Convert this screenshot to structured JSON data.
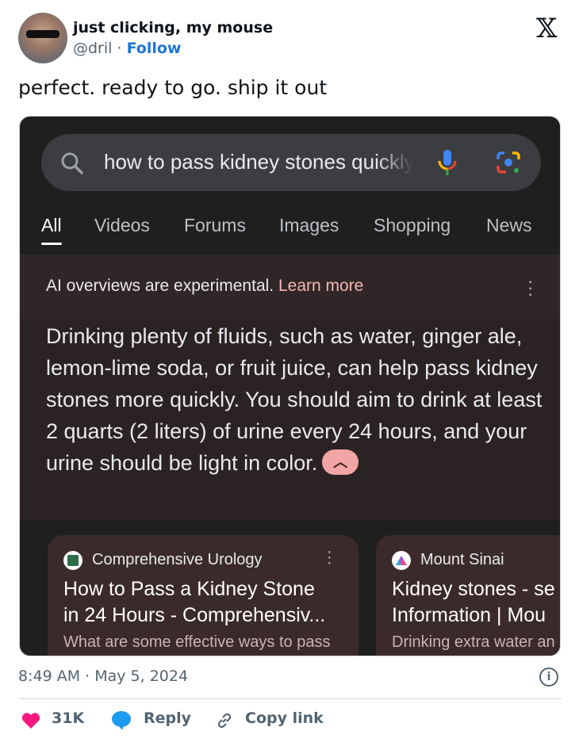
{
  "author": {
    "name": "just clicking, my mouse",
    "handle": "@dril",
    "separator": "·",
    "follow_label": "Follow"
  },
  "platform_icon": "x-logo-icon",
  "platform_logo_text": "𝕏",
  "tweet_text": "perfect. ready to go. ship it out",
  "screenshot": {
    "search_query": "how to pass kidney stones quickly",
    "tabs": [
      {
        "label": "All",
        "active": true
      },
      {
        "label": "Videos"
      },
      {
        "label": "Forums"
      },
      {
        "label": "Images"
      },
      {
        "label": "Shopping"
      },
      {
        "label": "News"
      }
    ],
    "ai_notice": "AI overviews are experimental.",
    "learn_more": "Learn more",
    "answer": "Drinking plenty of fluids, such as water, ginger ale, lemon-lime soda, or fruit juice, can help pass kidney stones more quickly. You should aim to drink at least 2 quarts (2 liters) of urine every 24 hours, and your urine should be light in color.",
    "cards": [
      {
        "source": "Comprehensive Urology",
        "title_line1": "How to Pass a Kidney Stone",
        "title_line2": "in 24 Hours - Comprehensiv...",
        "snippet": "What are some effective ways to pass"
      },
      {
        "source": "Mount Sinai",
        "title_line1": "Kidney stones - se",
        "title_line2": "Information | Mou",
        "snippet": "Drinking extra water an"
      }
    ],
    "colors": {
      "background": "#1f1f1f",
      "search_bar": "#3c3d40",
      "ai_panel": "#2b2323",
      "card": "#3b2a2a",
      "link": "#f2b8b5"
    }
  },
  "timestamp": "8:49 AM · May 5, 2024",
  "actions": {
    "likes": "31K",
    "reply": "Reply",
    "copy_link": "Copy link"
  },
  "colors": {
    "follow": "#1d77d2",
    "like": "#f91880",
    "reply": "#1d9bf0"
  }
}
